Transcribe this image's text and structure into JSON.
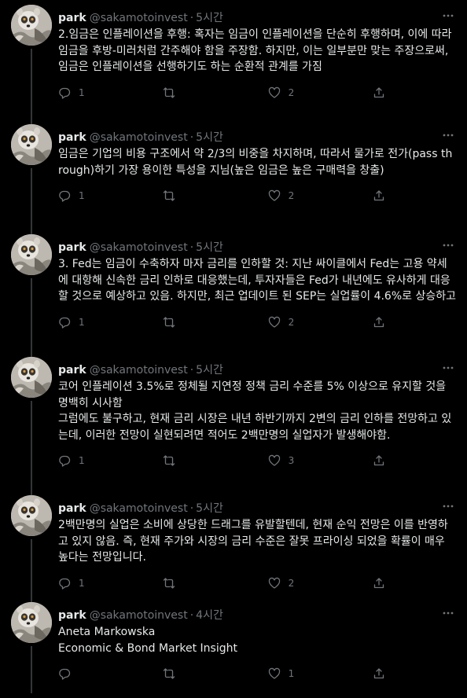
{
  "tweets": [
    {
      "name": "park",
      "handle": "@sakamotoinvest",
      "time": "5시간",
      "text": "2.임금은 인플레이션을 후행: 혹자는 임금이 인플레이션을 단순히 후행하며, 이에 따라 임금을 후방-미러처럼 간주해야 함을 주장함. 하지만, 이는 일부분만 맞는 주장으로써, 임금은 인플레이션을 선행하기도 하는 순환적 관계를 가짐",
      "replies": "1",
      "retweets": "",
      "likes": "2"
    },
    {
      "name": "park",
      "handle": "@sakamotoinvest",
      "time": "5시간",
      "text": "임금은 기업의 비용 구조에서 약 2/3의 비중을 차지하며, 따라서 물가로 전가(pass through)하기 가장 용이한 특성을 지님(높은 임금은 높은 구매력을 창출)",
      "replies": "1",
      "retweets": "",
      "likes": "2"
    },
    {
      "name": "park",
      "handle": "@sakamotoinvest",
      "time": "5시간",
      "text": "3. Fed는 임금이 수축하자 마자 금리를 인하할 것: 지난 싸이클에서 Fed는 고용 약세에 대항해 신속한 금리 인하로 대응했는데, 투자자들은 Fed가 내년에도 유사하게 대응할 것으로 예상하고 있음. 하지만, 최근 업데이트 된 SEP는 실업률이 4.6%로 상승하고",
      "replies": "1",
      "retweets": "",
      "likes": "2"
    },
    {
      "name": "park",
      "handle": "@sakamotoinvest",
      "time": "5시간",
      "text": "코어 인플레이션 3.5%로 정체될 지연정 정책 금리 수준를 5% 이상으로 유지할 것을 명백히 시사함\n그럼에도 불구하고, 현재 금리 시장은 내년 하반기까지 2변의 금리 인하를 전망하고 있는데, 이러한 전망이 실현되려면 적어도 2백만명의 실업자가 발생해야함.",
      "replies": "1",
      "retweets": "",
      "likes": "3"
    },
    {
      "name": "park",
      "handle": "@sakamotoinvest",
      "time": "5시간",
      "text": "2백만명의 실업은 소비에 상당한 드래그를 유발할텐데, 현재 순익 전망은 이를 반영하고 있지 않음. 즉, 현재 주가와 시장의 금리 수준은 잘못 프라이싱 되었을 확률이 매우 높다는 전망입니다.",
      "replies": "1",
      "retweets": "",
      "likes": "2"
    },
    {
      "name": "park",
      "handle": "@sakamotoinvest",
      "time": "4시간",
      "text": "Aneta Markowska\nEconomic & Bond Market Insight",
      "replies": "",
      "retweets": "",
      "likes": "1"
    }
  ],
  "icons": [
    "reply-icon",
    "retweet-icon",
    "like-icon",
    "share-icon",
    "more-icon"
  ],
  "colors": {
    "background": "#000000",
    "text": "#e7e9ea",
    "muted": "#71767b",
    "thread_line": "#333639"
  }
}
